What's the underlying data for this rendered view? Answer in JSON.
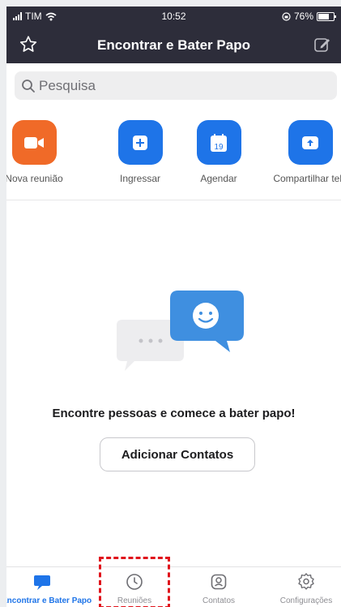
{
  "status_bar": {
    "carrier": "TIM",
    "time": "10:52",
    "battery": "76%"
  },
  "header": {
    "title": "Encontrar e Bater Papo"
  },
  "search": {
    "placeholder": "Pesquisa"
  },
  "actions": [
    {
      "label": "Nova reunião",
      "icon": "video-camera-icon",
      "color": "#f06a28"
    },
    {
      "label": "Ingressar",
      "icon": "plus-icon",
      "color": "#1e74e8"
    },
    {
      "label": "Agendar",
      "icon": "calendar-icon",
      "color": "#1e74e8",
      "calendar_day": "19"
    },
    {
      "label": "Compartilhar tela",
      "icon": "share-screen-icon",
      "color": "#1e74e8"
    }
  ],
  "empty_state": {
    "message": "Encontre pessoas e comece a bater papo!",
    "button_label": "Adicionar Contatos"
  },
  "tabbar": {
    "items": [
      {
        "label": "Encontrar e Bater Papo",
        "icon": "chat-bubble-icon",
        "active": true
      },
      {
        "label": "Reuniões",
        "icon": "clock-icon",
        "active": false
      },
      {
        "label": "Contatos",
        "icon": "contact-icon",
        "active": false
      },
      {
        "label": "Configurações",
        "icon": "gear-icon",
        "active": false
      }
    ]
  },
  "colors": {
    "accent": "#1e74e8",
    "header_bg": "#2d2d3a",
    "highlight": "#e0141c"
  }
}
